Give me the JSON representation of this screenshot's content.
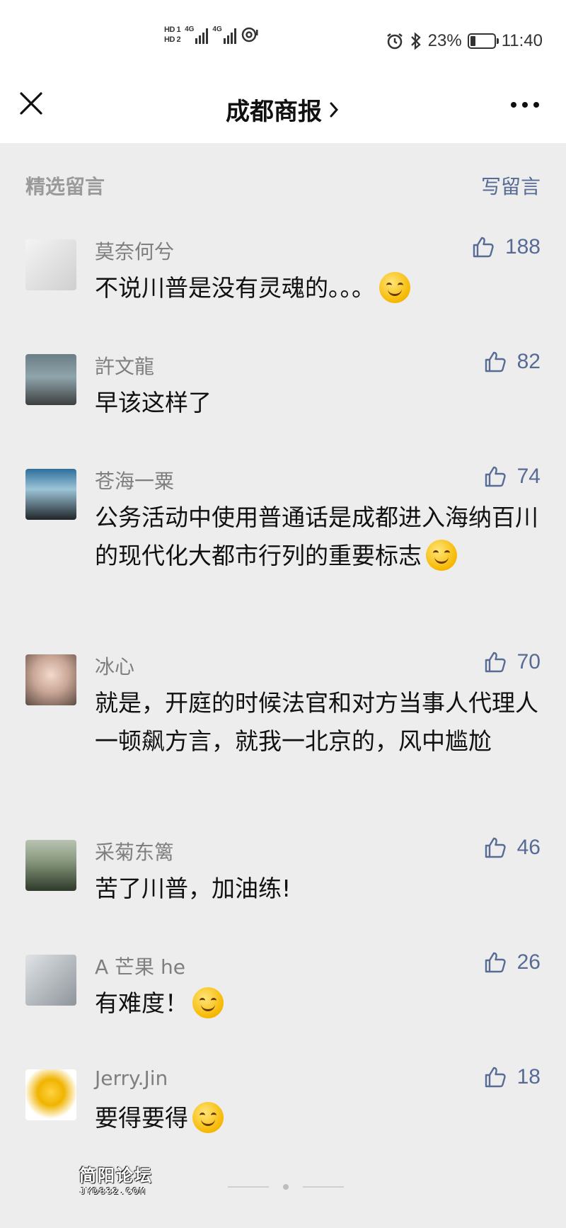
{
  "status_bar": {
    "hd1": "HD 1",
    "hd2": "HD 2",
    "net1": "4G",
    "net2": "4G",
    "battery_percent": "23%",
    "battery_level": 0.23,
    "time": "11:40"
  },
  "nav": {
    "title": "成都商报",
    "chevron": "›",
    "close_icon": "close-icon",
    "more_icon": "more-icon"
  },
  "section": {
    "title": "精选留言",
    "write_label": "写留言"
  },
  "comments": [
    {
      "name": "莫奈何兮",
      "likes": "188",
      "text": "不说川普是没有灵魂的。。。",
      "emoji": "smirk-emoji"
    },
    {
      "name": "許文龍",
      "likes": "82",
      "text": "早该这样了",
      "emoji": ""
    },
    {
      "name": "苍海一粟",
      "likes": "74",
      "text": "公务活动中使用普通话是成都进入海纳百川的现代化大都市行列的重要标志",
      "emoji": "hug-emoji"
    },
    {
      "name": "冰心",
      "likes": "70",
      "text": "就是，开庭的时候法官和对方当事人代理人一顿飙方言，就我一北京的，风中尴尬",
      "emoji": ""
    },
    {
      "name": "采菊东篱",
      "likes": "46",
      "text": "苦了川普，加油练!",
      "emoji": ""
    },
    {
      "name": "A 芒果 he",
      "likes": "26",
      "text": "有难度！",
      "emoji": "grin-emoji"
    },
    {
      "name": "Jerry.Jin",
      "likes": "18",
      "text": "要得要得",
      "emoji": "thinking-emoji"
    }
  ],
  "watermark": {
    "title": "简阳论坛",
    "url": "JYD832.COM"
  },
  "colors": {
    "link": "#576b95",
    "background": "#ededed",
    "name": "#7f7f7f"
  }
}
